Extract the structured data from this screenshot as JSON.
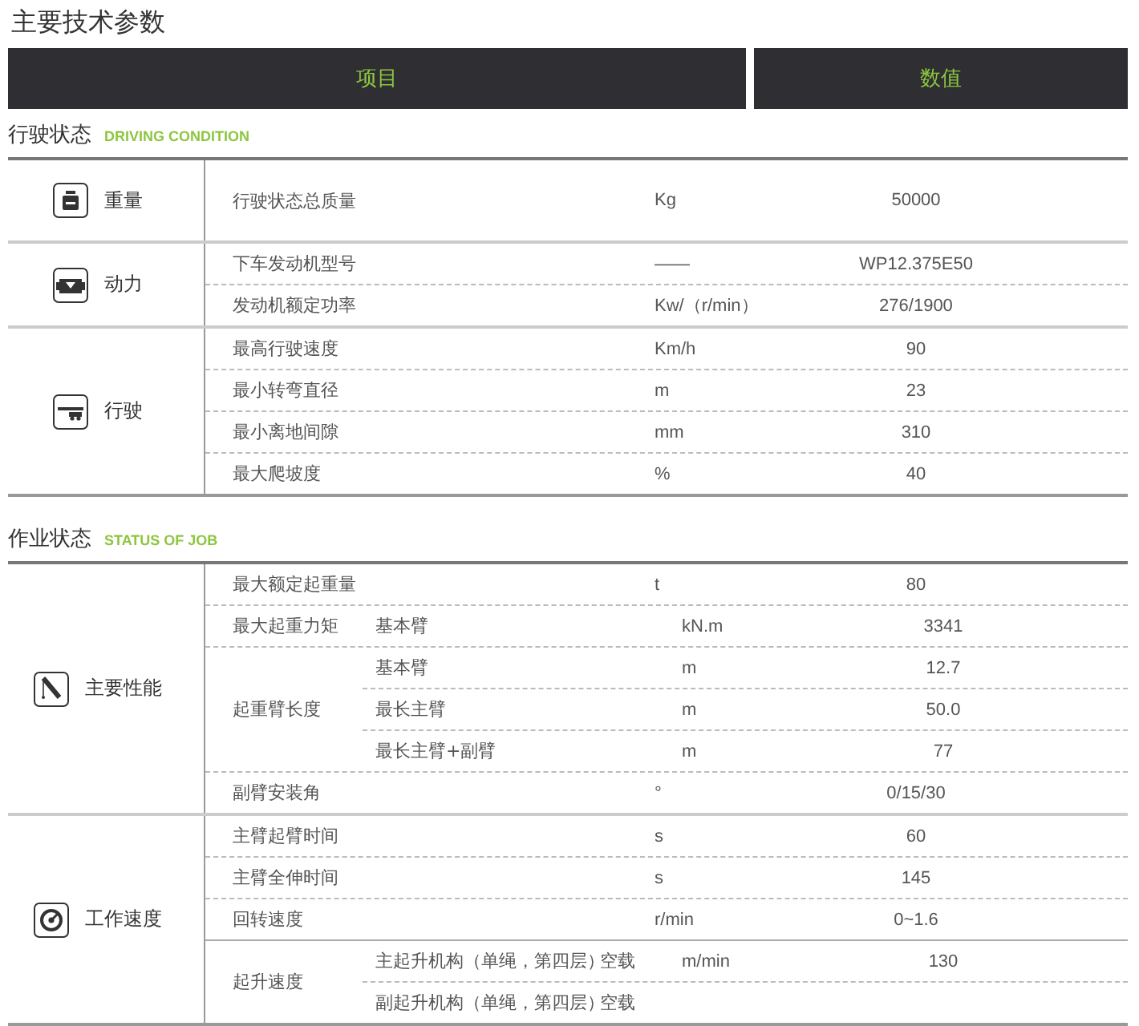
{
  "title": "主要技术参数",
  "header": {
    "item": "项目",
    "value": "数值"
  },
  "sections": [
    {
      "title": "行驶状态",
      "subtitle": "DRIVING CONDITION",
      "groups": [
        {
          "name": "重量",
          "rows": [
            {
              "label": "行驶状态总质量",
              "unit": "Kg",
              "value": "50000"
            }
          ]
        },
        {
          "name": "动力",
          "rows": [
            {
              "label": "下车发动机型号",
              "unit": "——",
              "value": "WP12.375E50"
            },
            {
              "label": "发动机额定功率",
              "unit": "Kw/（r/min）",
              "value": "276/1900"
            }
          ]
        },
        {
          "name": "行驶",
          "rows": [
            {
              "label": "最高行驶速度",
              "unit": "Km/h",
              "value": "90"
            },
            {
              "label": "最小转弯直径",
              "unit": "m",
              "value": "23"
            },
            {
              "label": "最小离地间隙",
              "unit": "mm",
              "value": "310"
            },
            {
              "label": "最大爬坡度",
              "unit": "%",
              "value": "40"
            }
          ]
        }
      ]
    },
    {
      "title": "作业状态",
      "subtitle": "STATUS OF JOB",
      "groups": [
        {
          "name": "主要性能",
          "rows": [
            {
              "label": "最大额定起重量",
              "unit": "t",
              "value": "80"
            },
            {
              "label": "最大起重力矩",
              "subrows": [
                {
                  "label": "基本臂",
                  "unit": "kN.m",
                  "value": "3341"
                }
              ]
            },
            {
              "label": "起重臂长度",
              "subrows": [
                {
                  "label": "基本臂",
                  "unit": "m",
                  "value": "12.7"
                },
                {
                  "label": "最长主臂",
                  "unit": "m",
                  "value": "50.0"
                },
                {
                  "label": "最长主臂+副臂",
                  "unit": "m",
                  "value": "77"
                }
              ]
            },
            {
              "label": "副臂安装角",
              "unit": "°",
              "value": "0/15/30"
            }
          ]
        },
        {
          "name": "工作速度",
          "rows": [
            {
              "label": "主臂起臂时间",
              "unit": "s",
              "value": "60"
            },
            {
              "label": "主臂全伸时间",
              "unit": "s",
              "value": "145"
            },
            {
              "label": "回转速度",
              "unit": "r/min",
              "value": "0~1.6"
            },
            {
              "label": "起升速度",
              "subrows": [
                {
                  "label": "主起升机构（单绳，第四层）",
                  "cond": "空载",
                  "unit": "m/min",
                  "value": "130"
                },
                {
                  "label": "副起升机构（单绳，第四层）",
                  "cond": "空载"
                }
              ]
            }
          ]
        }
      ]
    }
  ]
}
